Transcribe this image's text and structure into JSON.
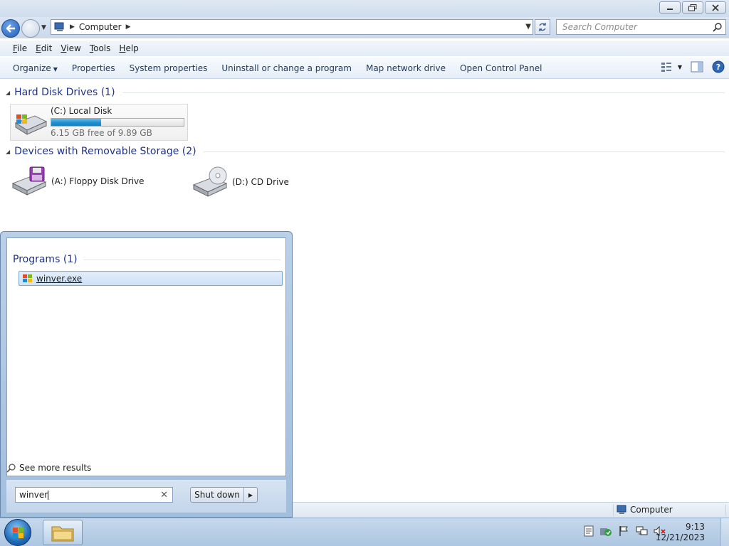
{
  "window": {
    "title_bar": {
      "buttons": [
        "minimize",
        "restore",
        "close"
      ]
    }
  },
  "address": {
    "crumb": "Computer",
    "search_placeholder": "Search Computer"
  },
  "menu": {
    "items": [
      {
        "label": "File",
        "accel": "F"
      },
      {
        "label": "Edit",
        "accel": "E"
      },
      {
        "label": "View",
        "accel": "V"
      },
      {
        "label": "Tools",
        "accel": "T"
      },
      {
        "label": "Help",
        "accel": "H"
      }
    ]
  },
  "commands": {
    "organize": "Organize",
    "properties": "Properties",
    "system_properties": "System properties",
    "uninstall": "Uninstall or change a program",
    "map_drive": "Map network drive",
    "control_panel": "Open Control Panel"
  },
  "groups": {
    "hard_disks": {
      "label": "Hard Disk Drives (1)"
    },
    "removable": {
      "label": "Devices with Removable Storage (2)"
    }
  },
  "drives": {
    "c": {
      "name": "(C:) Local Disk",
      "free_text": "6.15 GB free of 9.89 GB",
      "used_fraction": 0.378
    },
    "a": {
      "name": "(A:) Floppy Disk Drive"
    },
    "d": {
      "name": "(D:) CD Drive"
    }
  },
  "start_menu": {
    "programs_header": "Programs (1)",
    "result": "winver.exe",
    "see_more": "See more results",
    "search_value": "winver",
    "shutdown": "Shut down"
  },
  "statusbar": {
    "location": "Computer"
  },
  "taskbar": {
    "time": "9:13",
    "date": "12/21/2023"
  },
  "colors": {
    "group_header": "#1e3287",
    "drive_fill": "#1d8fd1",
    "selection": "#cfe1f7"
  }
}
